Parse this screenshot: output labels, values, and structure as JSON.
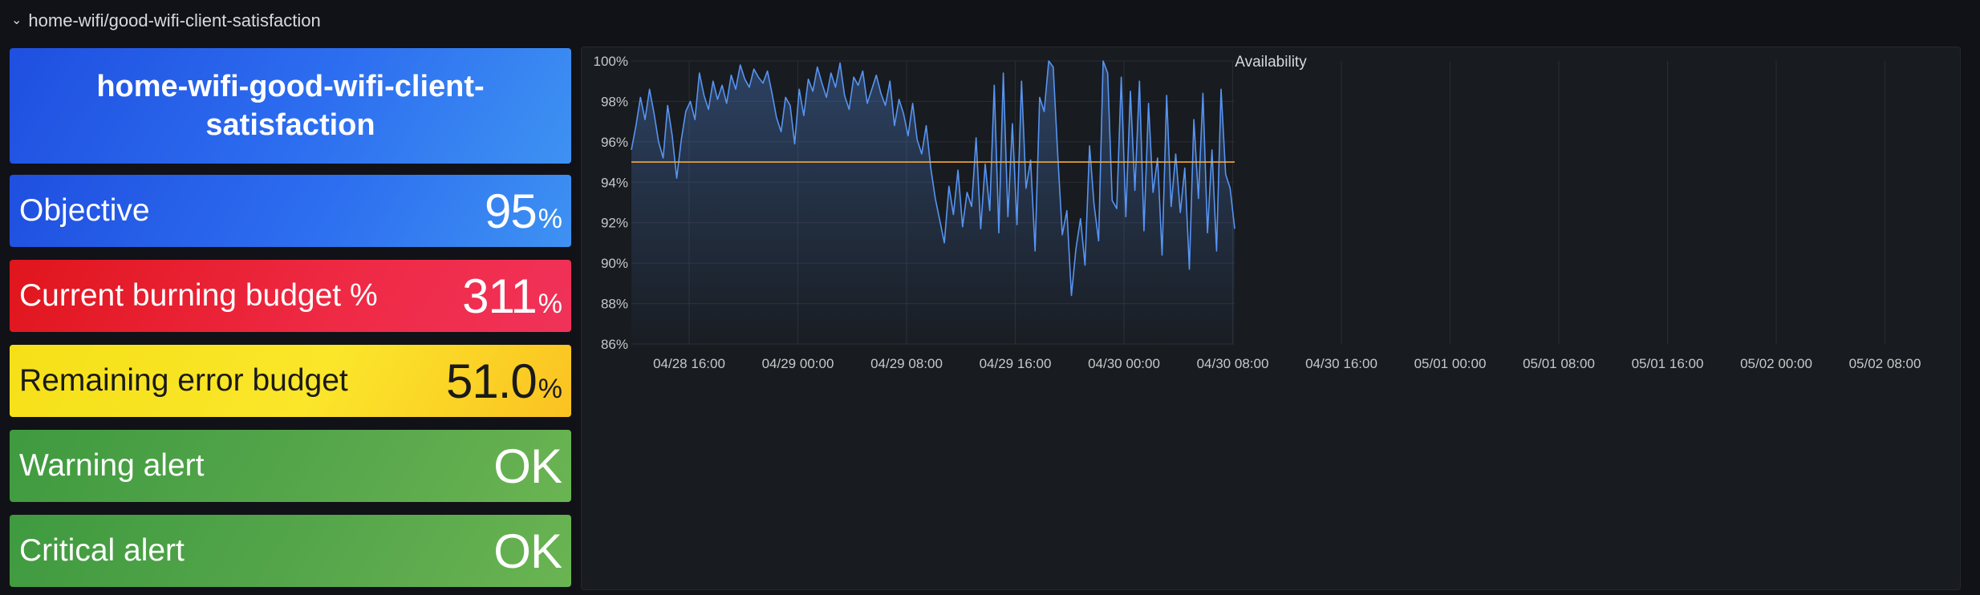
{
  "row": {
    "chevron": "⌄",
    "title": "home-wifi/good-wifi-client-satisfaction"
  },
  "panels": {
    "slo_name": "home-wifi-good-wifi-client-satisfaction",
    "objective": {
      "label": "Objective",
      "value": "95",
      "unit": "%"
    },
    "burning": {
      "label": "Current burning budget %",
      "value": "311",
      "unit": "%"
    },
    "remaining": {
      "label": "Remaining error budget",
      "value": "51.0",
      "unit": "%"
    },
    "warning": {
      "label": "Warning alert",
      "value": "OK"
    },
    "critical": {
      "label": "Critical alert",
      "value": "OK"
    }
  },
  "colors": {
    "line": "#5794f2",
    "threshold": "#f2a93b",
    "grid": "#2a2d33"
  },
  "chart_data": {
    "type": "area",
    "title": "Availability",
    "ylim": [
      86,
      100
    ],
    "y_ticks": [
      "100%",
      "98%",
      "96%",
      "94%",
      "92%",
      "90%",
      "88%",
      "86%"
    ],
    "x_ticks": [
      "04/28 16:00",
      "04/29 00:00",
      "04/29 08:00",
      "04/29 16:00",
      "04/30 00:00",
      "04/30 08:00",
      "04/30 16:00",
      "05/01 00:00",
      "05/01 08:00",
      "05/01 16:00",
      "05/02 00:00",
      "05/02 08:00"
    ],
    "threshold": 95,
    "series": [
      {
        "values": [
          95.6,
          96.8,
          98.2,
          97.1,
          98.6,
          97.4,
          96.0,
          95.2,
          97.8,
          96.3,
          94.2,
          96.1,
          97.5,
          98.0,
          97.1,
          99.4,
          98.3,
          97.6,
          99.0,
          98.1,
          98.8,
          97.9,
          99.3,
          98.6,
          99.8,
          99.1,
          98.7,
          99.6,
          99.2,
          98.9,
          99.5,
          98.4,
          97.2,
          96.5,
          98.2,
          97.8,
          95.9,
          98.6,
          97.3,
          99.1,
          98.5,
          99.7,
          98.9,
          98.2,
          99.4,
          98.7,
          99.9,
          98.3,
          97.6,
          99.2,
          98.8,
          99.5,
          97.9,
          98.6,
          99.3,
          98.4,
          97.8,
          99.0,
          96.8,
          98.1,
          97.4,
          96.3,
          97.9,
          96.1,
          95.4,
          96.8,
          94.7,
          93.2,
          92.1,
          91.0,
          93.8,
          92.4,
          94.6,
          91.8,
          93.5,
          92.8,
          96.2,
          91.7,
          94.9,
          92.6,
          98.8,
          91.5,
          99.4,
          92.3,
          96.9,
          91.9,
          99.0,
          93.7,
          95.1,
          90.6,
          98.2,
          97.5,
          100.0,
          99.7,
          95.3,
          91.4,
          92.6,
          88.4,
          90.7,
          92.2,
          89.9,
          95.8,
          92.9,
          91.1,
          100.0,
          99.4,
          93.1,
          92.7,
          99.2,
          92.3,
          98.5,
          93.6,
          99.0,
          91.6,
          97.9,
          93.5,
          95.2,
          90.4,
          98.3,
          92.8,
          95.4,
          92.5,
          94.7,
          89.7,
          97.1,
          93.2,
          98.4,
          91.5,
          95.6,
          90.6,
          98.6,
          94.4,
          93.7,
          91.7
        ]
      }
    ]
  }
}
